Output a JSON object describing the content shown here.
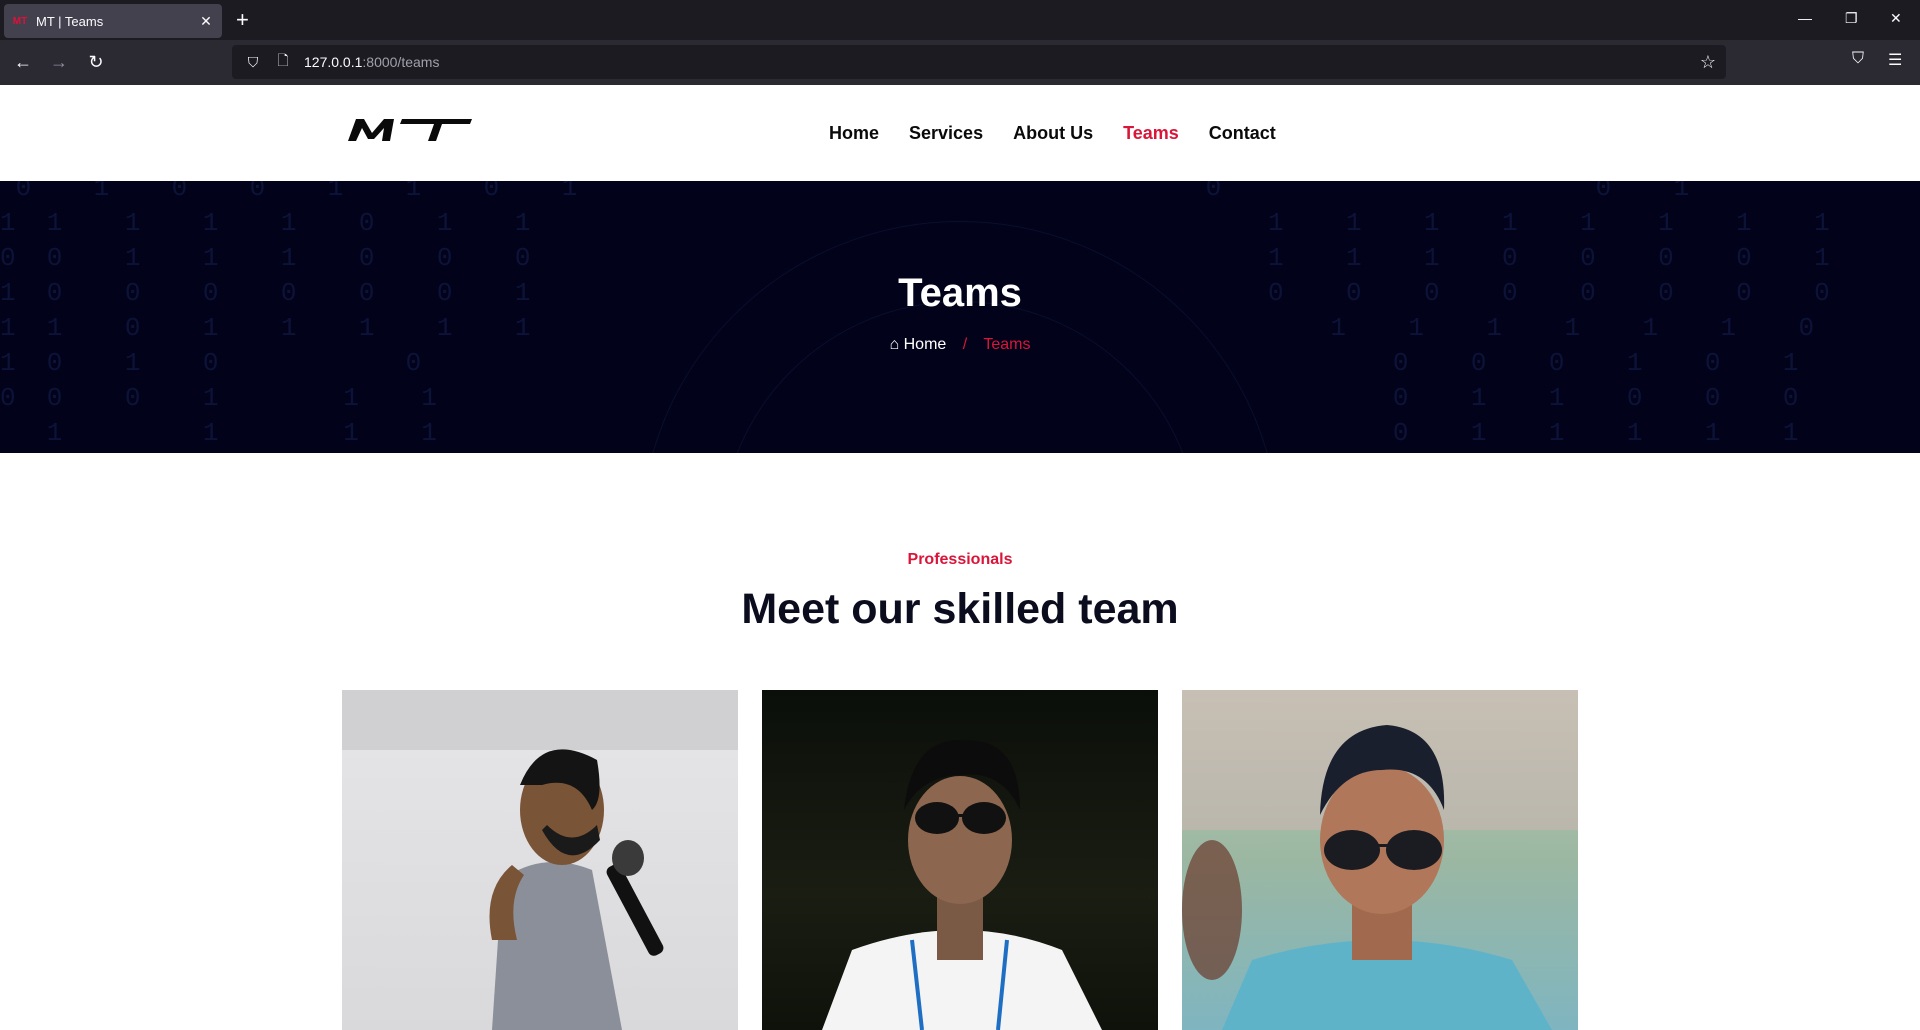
{
  "browser": {
    "tab_title": "MT | Teams",
    "favicon_text": "MT",
    "url_host": "127.0.0.1",
    "url_path": ":8000/teams"
  },
  "site": {
    "nav": [
      {
        "label": "Home"
      },
      {
        "label": "Services"
      },
      {
        "label": "About Us"
      },
      {
        "label": "Teams"
      },
      {
        "label": "Contact"
      }
    ],
    "active_nav": "Teams",
    "accent_color": "#d9163a"
  },
  "hero": {
    "title": "Teams",
    "breadcrumb_home": "Home",
    "breadcrumb_sep": "/",
    "breadcrumb_current": "Teams"
  },
  "team": {
    "subtitle": "Professionals",
    "heading": "Meet our skilled team",
    "members": [
      {
        "photo": "man-with-microphone"
      },
      {
        "photo": "man-with-sunglasses"
      },
      {
        "photo": "man-with-sunglasses-outdoor"
      }
    ]
  }
}
